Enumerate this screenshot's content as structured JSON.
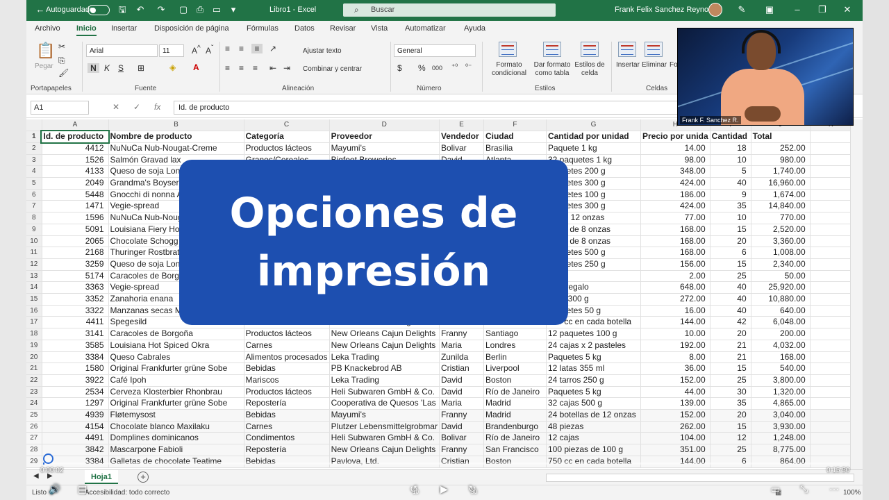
{
  "titlebar": {
    "autosave_label": "Autoguardado",
    "doc_title": "Libro1  -  Excel",
    "search_placeholder": "Buscar",
    "user_name": "Frank Felix Sanchez Reynoso"
  },
  "menu_tabs": [
    "Archivo",
    "Inicio",
    "Insertar",
    "Disposición de página",
    "Fórmulas",
    "Datos",
    "Revisar",
    "Vista",
    "Automatizar",
    "Ayuda"
  ],
  "ribbon": {
    "clipboard": {
      "paste": "Pegar",
      "group": "Portapapeles"
    },
    "font": {
      "family": "Arial",
      "size": "11",
      "bold": "N",
      "italic": "K",
      "underline": "S",
      "group": "Fuente"
    },
    "alignment": {
      "wrap": "Ajustar texto",
      "merge": "Combinar y centrar",
      "group": "Alineación"
    },
    "number": {
      "format": "General",
      "currency": "$",
      "percent": "%",
      "thousands": "000",
      "group": "Número"
    },
    "styles": {
      "conditional": "Formato condicional",
      "as_table": "Dar formato como tabla",
      "cell_styles": "Estilos de celda",
      "group": "Estilos"
    },
    "cells": {
      "insert": "Insertar",
      "delete": "Eliminar",
      "format": "Fo",
      "group": "Celdas"
    }
  },
  "formula_bar": {
    "name_box": "A1",
    "fx": "fx",
    "content": "Id. de producto"
  },
  "columns": [
    "A",
    "B",
    "C",
    "D",
    "E",
    "F",
    "G",
    "H",
    "I",
    "J",
    "K"
  ],
  "headers": [
    "Id. de producto",
    "Nombre de producto",
    "Categoría",
    "Proveedor",
    "Vendedor",
    "Ciudad",
    "Cantidad por unidad",
    "Precio por unida",
    "Cantidad",
    "Total"
  ],
  "rows": [
    [
      "4412",
      "NuNuCa Nub-Nougat-Creme",
      "Productos lácteos",
      "Mayumi's",
      "Bolivar",
      "Brasilia",
      "Paquete 1 kg",
      "14.00",
      "18",
      "252.00"
    ],
    [
      "1526",
      "Salmón Gravad lax",
      "Granos/Cereales",
      "Bigfoot Breweries",
      "David",
      "Atlanta",
      "32 paquetes 1 kg",
      "98.00",
      "10",
      "980.00"
    ],
    [
      "4133",
      "Queso de soja Lon",
      "",
      "",
      "",
      "",
      "paquetes 200 g",
      "348.00",
      "5",
      "1,740.00"
    ],
    [
      "2049",
      "Grandma's Boyser",
      "",
      "",
      "",
      "",
      "paquetes 300 g",
      "424.00",
      "40",
      "16,960.00"
    ],
    [
      "5448",
      "Gnocchi di nonna A",
      "",
      "",
      "",
      "",
      "paquetes 100 g",
      "186.00",
      "9",
      "1,674.00"
    ],
    [
      "1471",
      "Vegie-spread",
      "",
      "",
      "",
      "",
      "paquetes 300 g",
      "424.00",
      "35",
      "14,840.00"
    ],
    [
      "1596",
      "NuNuCa Nub-Noug",
      "",
      "",
      "",
      "",
      "as de 12 onzas",
      "77.00",
      "10",
      "770.00"
    ],
    [
      "5091",
      "Louisiana Fiery Ho",
      "",
      "",
      "",
      "",
      "tellas de 8 onzas",
      "168.00",
      "15",
      "2,520.00"
    ],
    [
      "2065",
      "Chocolate Schogg",
      "",
      "",
      "",
      "",
      "tellas de 8 onzas",
      "168.00",
      "20",
      "3,360.00"
    ],
    [
      "2168",
      "Thuringer Rostbrat",
      "",
      "",
      "",
      "",
      "paquetes 500 g",
      "168.00",
      "6",
      "1,008.00"
    ],
    [
      "3259",
      "Queso de soja Lon",
      "",
      "",
      "",
      "",
      "paquetes 250 g",
      "156.00",
      "15",
      "2,340.00"
    ],
    [
      "5174",
      "Caracoles de Borg",
      "",
      "",
      "",
      "",
      "",
      "2.00",
      "25",
      "50.00"
    ],
    [
      "3363",
      "Vegie-spread",
      "",
      "",
      "",
      "",
      "ajas regalo",
      "648.00",
      "40",
      "25,920.00"
    ],
    [
      "3352",
      "Zanahoria enana",
      "",
      "",
      "",
      "",
      "ezas 300 g",
      "272.00",
      "40",
      "10,880.00"
    ],
    [
      "3322",
      "Manzanas secas M",
      "",
      "",
      "",
      "",
      "paquetes 50 g",
      "16.00",
      "40",
      "640.00"
    ],
    [
      "4411",
      "Spegesild",
      "Bebidas",
      "Plutzer Lebensmittelgrobmar",
      "David",
      "Bari",
      "750 cc en cada botella",
      "144.00",
      "42",
      "6,048.00"
    ],
    [
      "3141",
      "Caracoles de Borgoña",
      "Productos lácteos",
      "New Orleans Cajun Delights",
      "Franny",
      "Santiago",
      "12 paquetes 100 g",
      "10.00",
      "20",
      "200.00"
    ],
    [
      "3585",
      "Louisiana Hot Spiced Okra",
      "Carnes",
      "New Orleans Cajun Delights",
      "Maria",
      "Londres",
      "24 cajas x 2 pasteles",
      "192.00",
      "21",
      "4,032.00"
    ],
    [
      "3384",
      "Queso Cabrales",
      "Alimentos procesados",
      "Leka Trading",
      "Zunilda",
      "Berlin",
      "Paquetes 5 kg",
      "8.00",
      "21",
      "168.00"
    ],
    [
      "1580",
      "Original Frankfurter grüne Sobe",
      "Bebidas",
      "PB Knackebrod AB",
      "Cristian",
      "Liverpool",
      "12 latas 355 ml",
      "36.00",
      "15",
      "540.00"
    ],
    [
      "3922",
      "Café Ipoh",
      "Mariscos",
      "Leka Trading",
      "David",
      "Boston",
      "24 tarros 250 g",
      "152.00",
      "25",
      "3,800.00"
    ],
    [
      "2534",
      "Cerveza Klosterbier Rhonbrau",
      "Productos lácteos",
      "Heli Subwaren GmbH & Co.",
      "David",
      "Río de Janeiro",
      "Paquetes 5 kg",
      "44.00",
      "30",
      "1,320.00"
    ],
    [
      "1297",
      "Original Frankfurter grüne Sobe",
      "Repostería",
      "Cooperativa de Quesos 'Las",
      "Maria",
      "Madrid",
      "32 cajas 500 g",
      "139.00",
      "35",
      "4,865.00"
    ],
    [
      "4939",
      "Fløtemysost",
      "Bebidas",
      "Mayumi's",
      "Franny",
      "Madrid",
      "24 botellas de 12 onzas",
      "152.00",
      "20",
      "3,040.00"
    ],
    [
      "4154",
      "Chocolate blanco Maxilaku",
      "Carnes",
      "Plutzer Lebensmittelgrobmar",
      "David",
      "Brandenburgo",
      "48 piezas",
      "262.00",
      "15",
      "3,930.00"
    ],
    [
      "4491",
      "Domplines dominicanos",
      "Condimentos",
      "Heli Subwaren GmbH & Co.",
      "Bolivar",
      "Río de Janeiro",
      "12 cajas",
      "104.00",
      "12",
      "1,248.00"
    ],
    [
      "3842",
      "Mascarpone Fabioli",
      "Repostería",
      "New Orleans Cajun Delights",
      "Franny",
      "San Francisco",
      "100 piezas de 100 g",
      "351.00",
      "25",
      "8,775.00"
    ],
    [
      "3384",
      "Galletas de chocolate Teatime",
      "Bebidas",
      "Pavlova, Ltd.",
      "Cristian",
      "Boston",
      "750 cc en cada botella",
      "144.00",
      "6",
      "864.00"
    ]
  ],
  "sheet_tabs": [
    "Hoja1"
  ],
  "status": {
    "ready": "Listo",
    "accessibility": "Accesibilidad: todo correcto",
    "zoom": "100%"
  },
  "overlay": {
    "title_line1": "Opciones de",
    "title_line2": "impresión",
    "webcam_name": "Frank F. Sanchez R.",
    "time_elapsed": "0:00:02",
    "time_total": "0:15:50",
    "progress_fraction": 0.002,
    "rewind_label": "10",
    "forward_label": "30"
  },
  "colors": {
    "excel_green": "#217346",
    "title_card": "#1d4fb0",
    "progress": "#2b6bd6"
  }
}
